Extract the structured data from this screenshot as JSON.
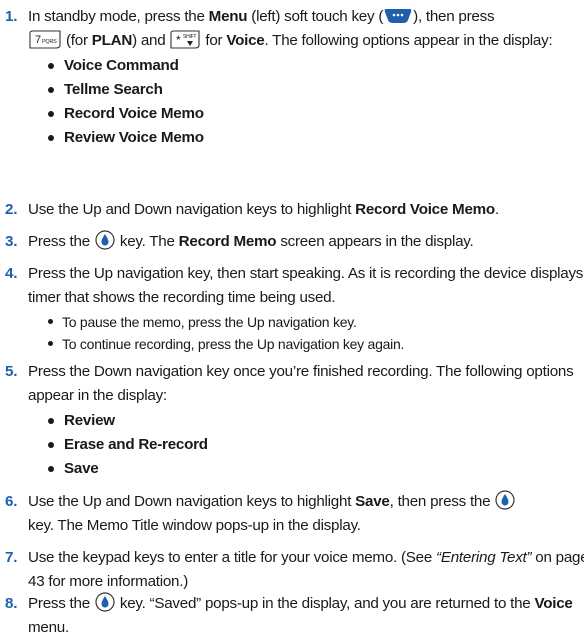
{
  "steps": [
    {
      "num": "1.",
      "parts": {
        "a": "In standby mode, press the ",
        "b": "Menu",
        "c": " (left) soft touch key (",
        "d": "), then press ",
        "e": " (for ",
        "f": "PLAN",
        "g": ") and ",
        "h": " for ",
        "i": "Voice",
        "j": ". The following options appear in the display:"
      },
      "options": [
        "Voice Command",
        "Tellme Search",
        "Record Voice Memo",
        "Review Voice Memo"
      ]
    },
    {
      "num": "2.",
      "parts": {
        "a": "Use the Up and Down navigation keys to highlight ",
        "b": "Record Voice Memo",
        "c": "."
      }
    },
    {
      "num": "3.",
      "parts": {
        "a": "Press the ",
        "b": " key. The ",
        "c": "Record Memo",
        "d": " screen appears in the display."
      }
    },
    {
      "num": "4.",
      "text": "Press the Up navigation key, then start speaking. As it is recording the device displays a timer that shows the recording time being used.",
      "subs": [
        "To pause the memo, press the Up navigation key.",
        "To continue recording, press the Up navigation key again."
      ]
    },
    {
      "num": "5.",
      "text": "Press the Down navigation key once you’re finished recording. The following options appear in the display:",
      "options": [
        "Review",
        "Erase and Re-record",
        "Save"
      ]
    },
    {
      "num": "6.",
      "parts": {
        "a": "Use the Up and Down navigation keys to highlight ",
        "b": "Save",
        "c": ", then press the ",
        "d": " key. The Memo Title window pops-up in the display."
      }
    },
    {
      "num": "7.",
      "parts": {
        "a": "Use the keypad keys to enter a title for your voice memo. (See ",
        "b": "“Entering Text”",
        "c": " on page 43 for more information.)"
      }
    },
    {
      "num": "8.",
      "parts": {
        "a": "Press the ",
        "b": " key. “Saved” pops-up in the display, and you are returned to the ",
        "c": "Voice",
        "d": " menu."
      }
    }
  ],
  "icons": {
    "menu_key": "menu-soft-key-icon",
    "key_7": "key-7-pqrs-icon",
    "key_star": "star-key-icon",
    "ok_key": "ok-key-icon"
  },
  "colors": {
    "step_number": "#1f5fae",
    "text": "#1a1a1a"
  }
}
